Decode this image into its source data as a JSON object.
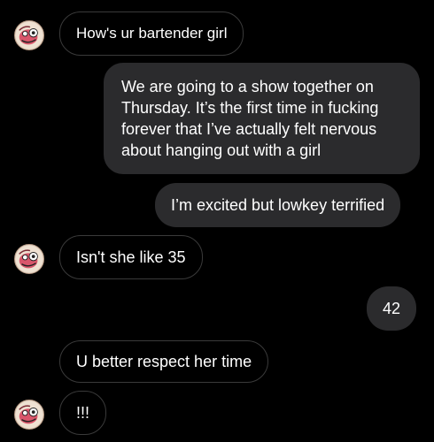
{
  "conversation": {
    "messages": [
      {
        "sender": "them",
        "text": "How's ur bartender girl",
        "avatar": "profile-avatar"
      },
      {
        "sender": "me",
        "text": "We are going to a show together on Thursday. It’s the first time in fucking forever that I’ve actually felt nervous about hanging out with a girl"
      },
      {
        "sender": "me",
        "text": "I’m excited but lowkey terrified"
      },
      {
        "sender": "them",
        "text": "Isn't she like 35",
        "avatar": "profile-avatar"
      },
      {
        "sender": "me",
        "text": "42"
      },
      {
        "sender": "them",
        "text": "U better respect her time"
      },
      {
        "sender": "them",
        "text": "!!!",
        "avatar": "profile-avatar"
      }
    ]
  },
  "colors": {
    "background": "#000000",
    "incoming_border": "#3a3a3a",
    "outgoing_bubble": "#2b2b2d",
    "text": "#ffffff"
  }
}
